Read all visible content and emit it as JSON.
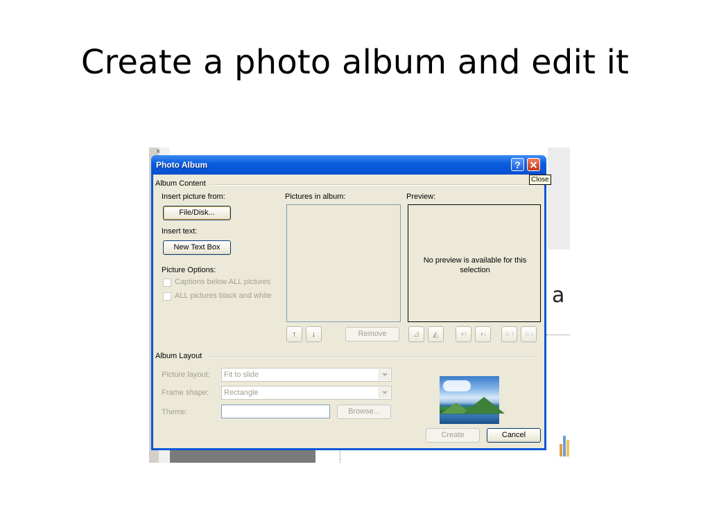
{
  "slide": {
    "title": "Create a photo album and edit it"
  },
  "background": {
    "letter": "a",
    "x_mark": "×"
  },
  "dialog": {
    "title": "Photo Album",
    "help_label": "?",
    "tooltip": "Close",
    "album_content": {
      "group_label": "Album Content",
      "insert_picture_from": "Insert picture from:",
      "file_disk_button": "File/Disk...",
      "insert_text": "Insert text:",
      "new_text_box_button": "New Text Box",
      "picture_options": "Picture Options:",
      "captions_option": "Captions below ALL pictures",
      "black_white_option": "ALL pictures black and white",
      "pictures_in_album": "Pictures in album:",
      "preview_label": "Preview:",
      "preview_message": "No preview is available for this selection",
      "move_up": "↑",
      "move_down": "↓",
      "remove_button": "Remove",
      "rotate_left": "⊿",
      "rotate_right": "◭",
      "contrast_up": "◑↑",
      "contrast_down": "◑↓",
      "brightness_up": "☼↑",
      "brightness_down": "☼↓"
    },
    "album_layout": {
      "group_label": "Album Layout",
      "picture_layout_label": "Picture layout:",
      "picture_layout_value": "Fit to slide",
      "frame_shape_label": "Frame shape:",
      "frame_shape_value": "Rectangle",
      "theme_label": "Theme:",
      "theme_value": "",
      "browse_button": "Browse..."
    },
    "footer": {
      "create_button": "Create",
      "cancel_button": "Cancel"
    }
  }
}
